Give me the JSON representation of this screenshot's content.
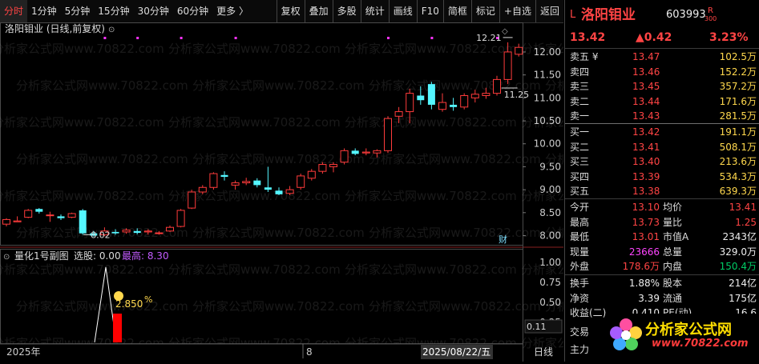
{
  "toolbar": {
    "left_tabs": [
      "分时",
      "1分钟",
      "5分钟",
      "15分钟",
      "30分钟",
      "60分钟",
      "更多 〉"
    ],
    "right_tools": [
      "复权",
      "叠加",
      "多股",
      "统计",
      "画线",
      "F10",
      "简框",
      "标记",
      "+自选",
      "返回"
    ]
  },
  "chart": {
    "title": "洛阳钼业 (日线,前复权)",
    "price_labels": [
      "12.00",
      "11.50",
      "11.00",
      "10.50",
      "10.00",
      "9.50",
      "9.00",
      "8.50",
      "8.00"
    ],
    "high_label": "12.21",
    "low_label": "8.02",
    "last_label": "11.25",
    "cai_icon": "财",
    "indicator": {
      "name": "量化1号副图",
      "select_text": "选股: 0.00",
      "max_label": "最高: 8.30",
      "pct_text": "2.850",
      "pct_unit": "%",
      "axis_labels": [
        "1.00",
        "0.75",
        "0.50",
        "0.25"
      ],
      "current_value": "0.11"
    },
    "date_labels": [
      "2025年",
      "8",
      "2025/08/22/五"
    ],
    "period": "日线"
  },
  "chart_data": {
    "type": "candlestick",
    "ylim": [
      7.8,
      12.4
    ],
    "candles": [
      [
        8.25,
        8.35,
        8.2,
        8.38
      ],
      [
        8.3,
        8.32,
        8.3,
        8.42
      ],
      [
        8.4,
        8.55,
        8.38,
        8.58
      ],
      [
        8.58,
        8.52,
        8.48,
        8.6
      ],
      [
        8.45,
        8.45,
        8.3,
        8.52
      ],
      [
        8.42,
        8.38,
        8.34,
        8.46
      ],
      [
        8.4,
        8.48,
        8.38,
        8.5
      ],
      [
        8.55,
        8.05,
        8.02,
        8.58
      ],
      [
        8.05,
        8.0,
        7.98,
        8.1
      ],
      [
        8.02,
        8.1,
        7.99,
        8.18
      ],
      [
        8.08,
        8.05,
        8.02,
        8.14
      ],
      [
        8.08,
        8.12,
        8.04,
        8.16
      ],
      [
        8.1,
        8.06,
        8.03,
        8.16
      ],
      [
        8.08,
        8.1,
        8.02,
        8.14
      ],
      [
        8.05,
        8.06,
        8.02,
        8.1
      ],
      [
        8.1,
        8.18,
        8.08,
        8.22
      ],
      [
        8.2,
        8.55,
        8.18,
        8.58
      ],
      [
        8.6,
        8.95,
        8.58,
        9.0
      ],
      [
        8.95,
        9.05,
        8.9,
        9.1
      ],
      [
        9.05,
        9.35,
        9.0,
        9.38
      ],
      [
        9.32,
        9.28,
        9.2,
        9.4
      ],
      [
        9.1,
        9.15,
        9.0,
        9.2
      ],
      [
        9.15,
        9.18,
        9.1,
        9.26
      ],
      [
        9.2,
        9.1,
        9.05,
        9.25
      ],
      [
        9.05,
        9.0,
        8.95,
        9.5
      ],
      [
        8.98,
        8.9,
        8.88,
        9.05
      ],
      [
        8.92,
        9.0,
        8.88,
        9.08
      ],
      [
        9.05,
        9.3,
        9.0,
        9.35
      ],
      [
        9.25,
        9.4,
        9.2,
        9.45
      ],
      [
        9.4,
        9.55,
        9.35,
        9.6
      ],
      [
        9.5,
        9.55,
        9.38,
        9.6
      ],
      [
        9.6,
        9.85,
        9.55,
        9.9
      ],
      [
        9.85,
        9.78,
        9.75,
        9.9
      ],
      [
        9.8,
        9.82,
        9.75,
        9.9
      ],
      [
        9.8,
        9.85,
        9.7,
        9.88
      ],
      [
        9.85,
        10.55,
        9.8,
        10.6
      ],
      [
        10.6,
        10.7,
        10.45,
        10.8
      ],
      [
        10.7,
        11.1,
        10.45,
        11.2
      ],
      [
        11.05,
        10.95,
        10.85,
        11.25
      ],
      [
        11.3,
        10.85,
        10.75,
        11.35
      ],
      [
        10.75,
        10.9,
        10.7,
        11.1
      ],
      [
        10.85,
        10.8,
        10.72,
        11.0
      ],
      [
        10.8,
        11.05,
        10.75,
        11.1
      ],
      [
        11.0,
        11.08,
        10.9,
        11.18
      ],
      [
        11.05,
        11.1,
        10.98,
        11.22
      ],
      [
        11.1,
        11.4,
        11.05,
        11.48
      ],
      [
        11.4,
        12.0,
        11.3,
        12.21
      ],
      [
        11.95,
        12.1,
        11.9,
        12.18
      ]
    ]
  },
  "right": {
    "title": "洛阳钼业",
    "code": "603993",
    "market_mark": "L",
    "rank_mark_top": "R",
    "rank_mark_bottom": "300",
    "price": "13.42",
    "change": "▲0.42",
    "change_pct": "3.23%",
    "asks": [
      {
        "label": "卖五 ¥",
        "price": "13.47",
        "vol": "102.5万"
      },
      {
        "label": "卖四",
        "price": "13.46",
        "vol": "152.2万"
      },
      {
        "label": "卖三",
        "price": "13.45",
        "vol": "357.2万"
      },
      {
        "label": "卖二",
        "price": "13.44",
        "vol": "171.6万"
      },
      {
        "label": "卖一",
        "price": "13.43",
        "vol": "281.5万"
      }
    ],
    "bids": [
      {
        "label": "买一",
        "price": "13.42",
        "vol": "191.1万"
      },
      {
        "label": "买二",
        "price": "13.41",
        "vol": "508.1万"
      },
      {
        "label": "买三",
        "price": "13.40",
        "vol": "213.6万"
      },
      {
        "label": "买四",
        "price": "13.39",
        "vol": "534.3万"
      },
      {
        "label": "买五",
        "price": "13.38",
        "vol": "639.3万"
      }
    ],
    "stats": [
      {
        "l1": "今开",
        "v1": "13.10",
        "l2": "均价",
        "v2": "13.41"
      },
      {
        "l1": "最高",
        "v1": "13.73",
        "l2": "量比",
        "v2": "1.25"
      },
      {
        "l1": "最低",
        "v1": "13.01",
        "l2": "市值A",
        "v2": "2343亿"
      },
      {
        "l1": "现量",
        "v1": "23666",
        "l2": "总量",
        "v2": "329.0万"
      },
      {
        "l1": "外盘",
        "v1": "178.6万",
        "l2": "内盘",
        "v2": "150.4万"
      }
    ],
    "stats2": [
      {
        "l1": "换手",
        "v1": "1.88%",
        "l2": "股本",
        "v2": "214亿"
      },
      {
        "l1": "净资",
        "v1": "3.39",
        "l2": "流通",
        "v2": "175亿"
      },
      {
        "l1": "收益(二)",
        "v1": "0.410",
        "l2": "PE(动)",
        "v2": "16.6"
      }
    ],
    "bottom_labels": [
      "交易",
      "主力"
    ],
    "logo_text": "分析家公式网",
    "logo_url": "www.70822.com"
  },
  "watermark": "分析家公式网www.70822.com",
  "colors": {
    "up": "#ff3b3b",
    "down": "#54f6ff",
    "bg": "#000000",
    "dot": "#ff33ff"
  }
}
